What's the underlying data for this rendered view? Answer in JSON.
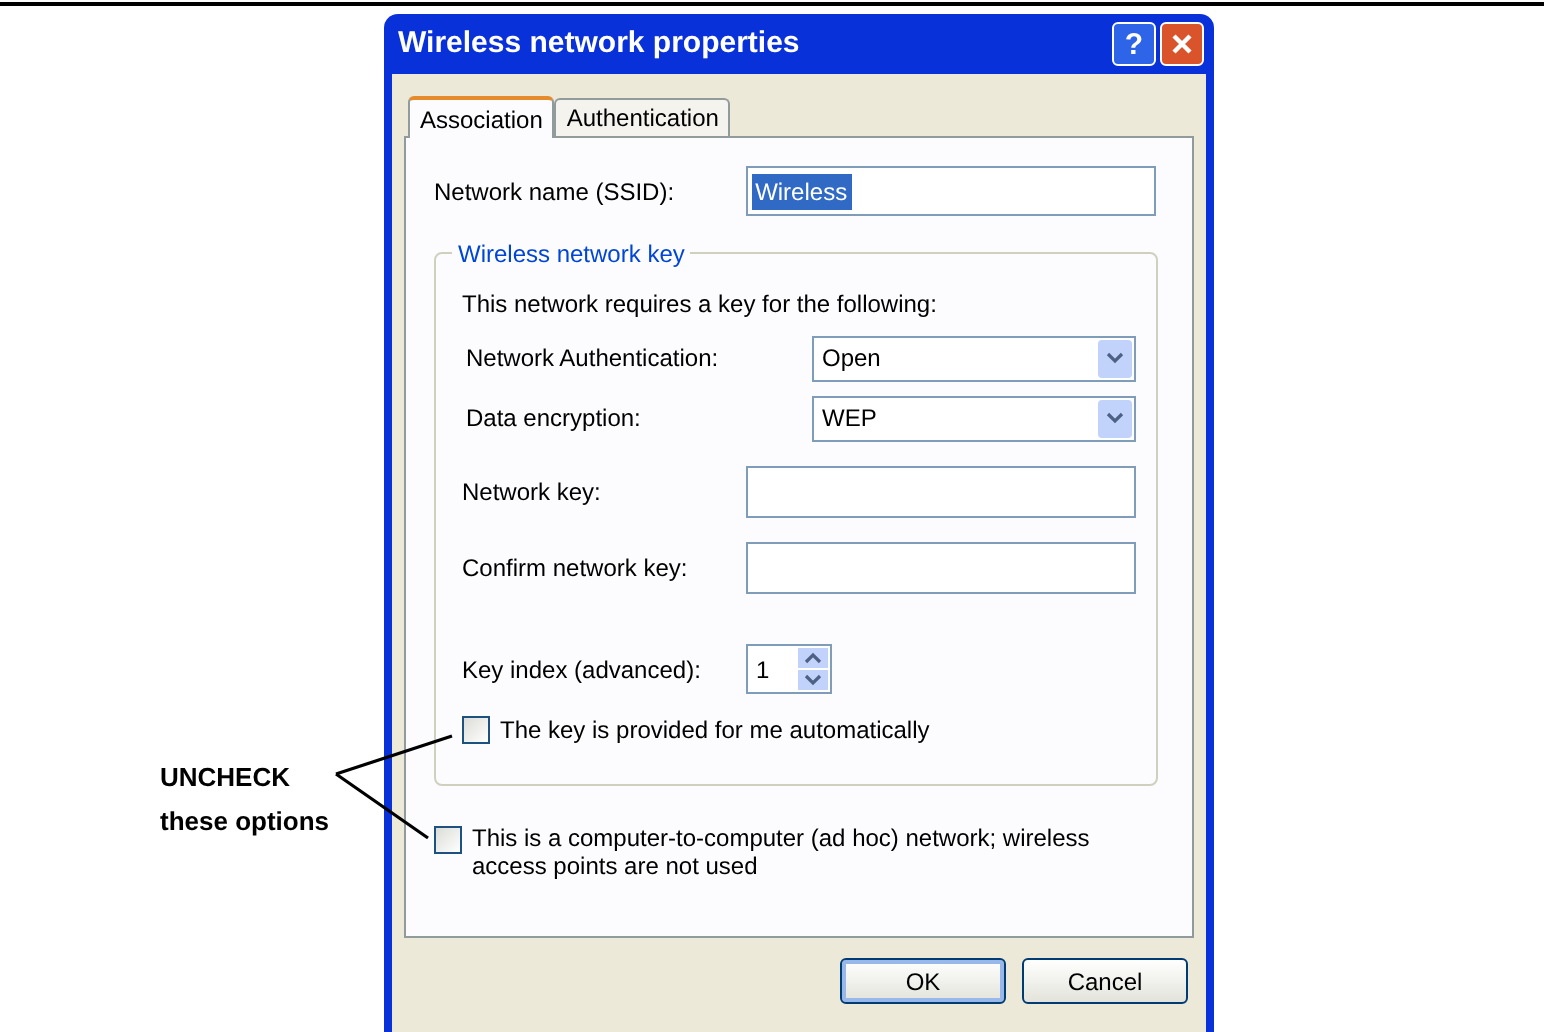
{
  "dialog": {
    "title": "Wireless network properties",
    "help_button": "?",
    "tabs": [
      {
        "label": "Association",
        "selected": true
      },
      {
        "label": "Authentication",
        "selected": false
      }
    ],
    "ssid": {
      "label": "Network name (SSID):",
      "value": "Wireless"
    },
    "key_group": {
      "title": "Wireless network key",
      "intro": "This network requires a key for the following:",
      "rows": [
        {
          "kind": "combo",
          "label": "Network Authentication:",
          "value": "Open"
        },
        {
          "kind": "combo",
          "label": "Data encryption:",
          "value": "WEP"
        },
        {
          "kind": "field",
          "label": "Network key:"
        },
        {
          "kind": "field",
          "label": "Confirm network key:"
        },
        {
          "kind": "spinner",
          "label": "Key index (advanced):",
          "value": "1"
        }
      ],
      "auto_key": {
        "label": "The key is provided for me automatically",
        "checked": false
      }
    },
    "adhoc": {
      "label": "This is a computer-to-computer (ad hoc) network; wireless access points are not used",
      "checked": false
    },
    "buttons": [
      "OK",
      "Cancel"
    ]
  },
  "annotation": {
    "lines": [
      "UNCHECK",
      "these options"
    ]
  }
}
